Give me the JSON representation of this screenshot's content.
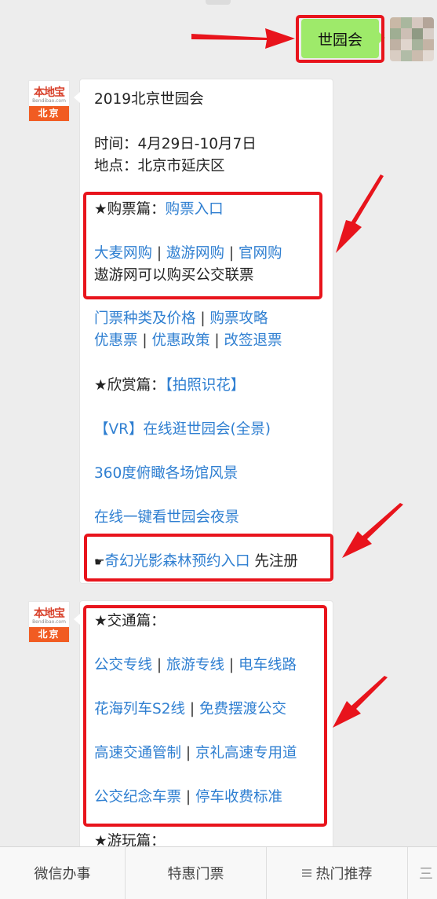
{
  "user_message": {
    "text": "世园会"
  },
  "bot_logo": {
    "brand": "本地宝",
    "sub": "Bendibao.com",
    "city": "北京"
  },
  "message1": {
    "title": "2019北京世园会",
    "time": "时间：4月29日-10月7日",
    "place": "地点：北京市延庆区",
    "tickets": {
      "heading": "★购票篇：",
      "entry_link": "购票入口",
      "links_row1": [
        "大麦网购",
        "遨游网购",
        "官网购"
      ],
      "note": "遨游网可以购买公交联票",
      "links_row2": [
        "门票种类及价格",
        "购票攻略"
      ],
      "links_row3": [
        "优惠票",
        "优惠政策",
        "改签退票"
      ]
    },
    "appreciate": {
      "heading": "★欣赏篇：",
      "photo_link": "【拍照识花】",
      "vr_link": "【VR】在线逛世园会(全景)",
      "aerial_link": "360度俯瞰各场馆风景",
      "night_link": "在线一键看世园会夜景",
      "pointer": "☛",
      "forest_link": "奇幻光影森林预约入口",
      "register_note": " 先注册"
    },
    "separator": " | "
  },
  "message2": {
    "heading": "★交通篇：",
    "rows": [
      [
        "公交专线",
        "旅游专线",
        "电车线路"
      ],
      [
        "花海列车S2线",
        "免费摆渡公交"
      ],
      [
        "高速交通管制",
        "京礼高速专用道"
      ],
      [
        "公交纪念车票",
        "停车收费标准"
      ]
    ],
    "next_heading": "★游玩篇："
  },
  "bottom_menu": {
    "items": [
      "微信办事",
      "特惠门票",
      "热门推荐",
      "三"
    ]
  },
  "colors": {
    "link": "#2f7fd1",
    "bubble_user": "#9eea6a",
    "annotation": "#e8141c",
    "brand": "#f15c22"
  }
}
